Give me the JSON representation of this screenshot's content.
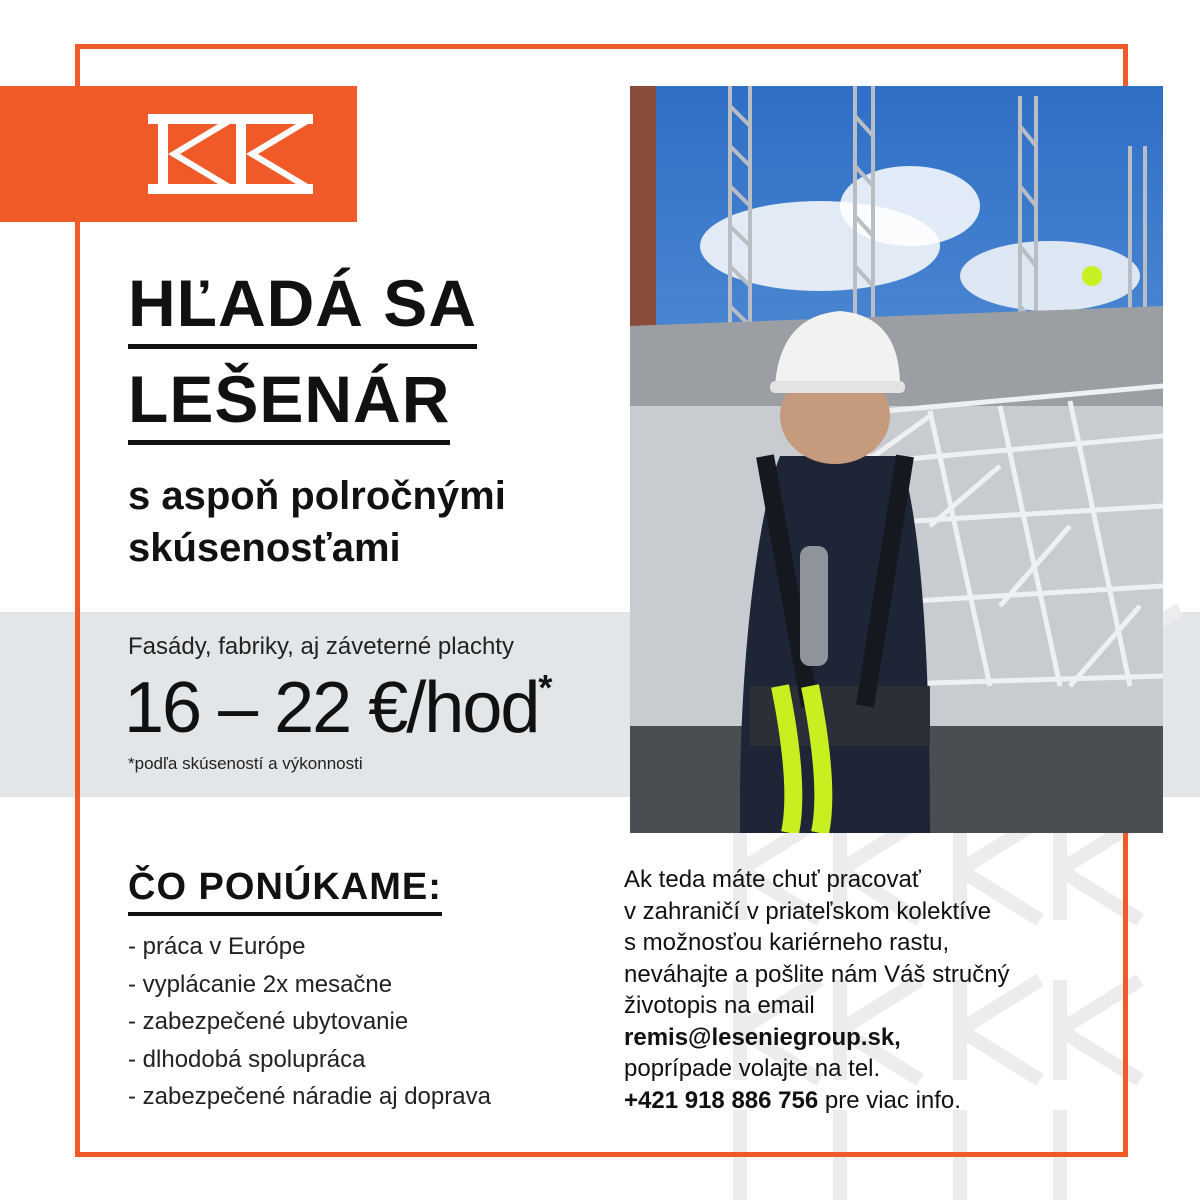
{
  "brand": {
    "accent_color": "#f05a28",
    "logo_icon": "kk-logo-icon"
  },
  "headline": {
    "line1": "HĽADÁ SA",
    "line2": "LEŠENÁR",
    "subtitle": "s aspoň polročnými\nskúsenosťami"
  },
  "wage": {
    "intro": "Fasády, fabriky, aj záveterné plachty",
    "range": "16 – 22 €/hod",
    "asterisk": "*",
    "note": "*podľa skúseností a výkonnosti"
  },
  "offers": {
    "title": "ČO PONÚKAME:",
    "items": [
      "- práca v Európe",
      "- vyplácanie 2x mesačne",
      "- zabezpečené ubytovanie",
      "- dlhodobá spolupráca",
      "- zabezpečené náradie aj doprava"
    ]
  },
  "contact": {
    "line1": "Ak teda máte chuť pracovať",
    "line2": "v zahraničí v priateľskom kolektíve",
    "line3": "s možnosťou kariérneho rastu,",
    "line4": "neváhajte a pošlite nám Váš stručný",
    "line5": "životopis na email",
    "email": "remis@leseniegroup.sk,",
    "line7": "poprípade volajte na tel.",
    "phone": "+421 918 886 756",
    "line8_tail": " pre viac info."
  },
  "photo": {
    "icon": "scaffolder-photo-icon"
  }
}
